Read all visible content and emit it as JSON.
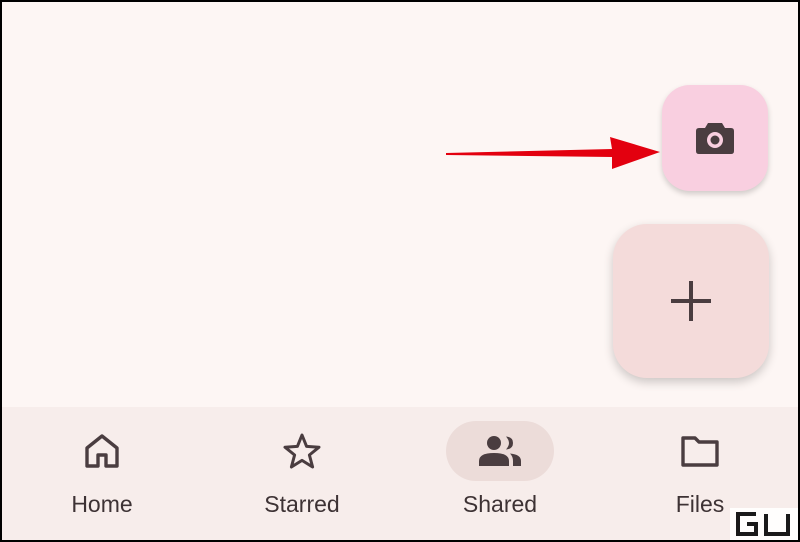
{
  "colors": {
    "background": "#fdf6f4",
    "nav_background": "#f7edeb",
    "active_pill": "#ecdcd9",
    "camera_fab": "#f9cfe0",
    "add_fab": "#f4dbda",
    "icon": "#4a3d40",
    "arrow": "#e3000f"
  },
  "fabs": {
    "camera": {
      "icon": "camera-icon"
    },
    "add": {
      "icon": "plus-icon"
    }
  },
  "nav": {
    "items": [
      {
        "label": "Home",
        "icon": "home-icon",
        "active": false
      },
      {
        "label": "Starred",
        "icon": "star-icon",
        "active": false
      },
      {
        "label": "Shared",
        "icon": "people-icon",
        "active": true
      },
      {
        "label": "Files",
        "icon": "folder-icon",
        "active": false
      }
    ]
  },
  "annotation": {
    "type": "arrow",
    "points_to": "camera-fab"
  },
  "watermark": {
    "text": "GU"
  }
}
